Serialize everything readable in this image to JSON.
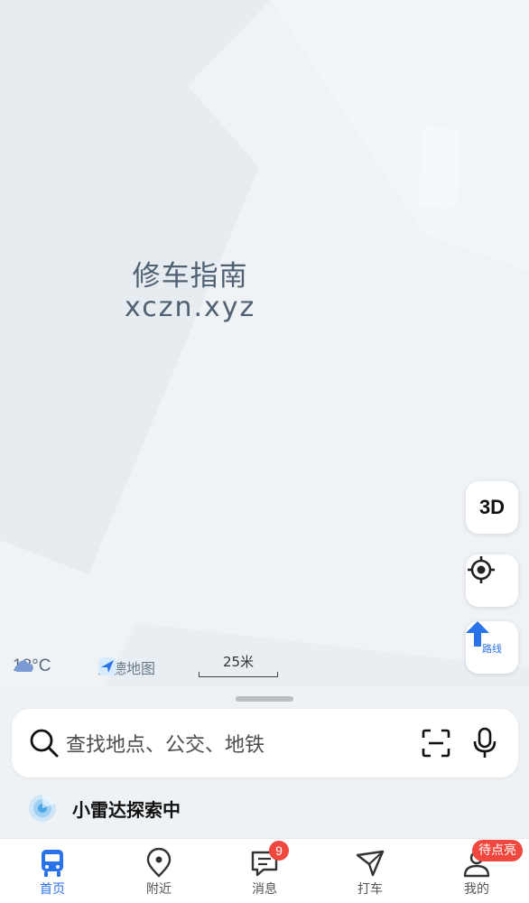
{
  "map": {
    "watermark_line1": "修车指南",
    "watermark_line2": "xczn.xyz",
    "btn_3d": "3D",
    "btn_route": "路线",
    "weather_temp": "18°C",
    "brand": "高德地图",
    "scale": "25米"
  },
  "search": {
    "placeholder": "查找地点、公交、地铁"
  },
  "radar": {
    "label": "小雷达探索中"
  },
  "tabs": [
    {
      "label": "首页"
    },
    {
      "label": "附近"
    },
    {
      "label": "消息",
      "badge": "9"
    },
    {
      "label": "打车"
    },
    {
      "label": "我的",
      "badge": "待点亮"
    }
  ],
  "colors": {
    "accent": "#2a72e8",
    "badge": "#f0473e",
    "map_bg": "#eff3f6"
  }
}
